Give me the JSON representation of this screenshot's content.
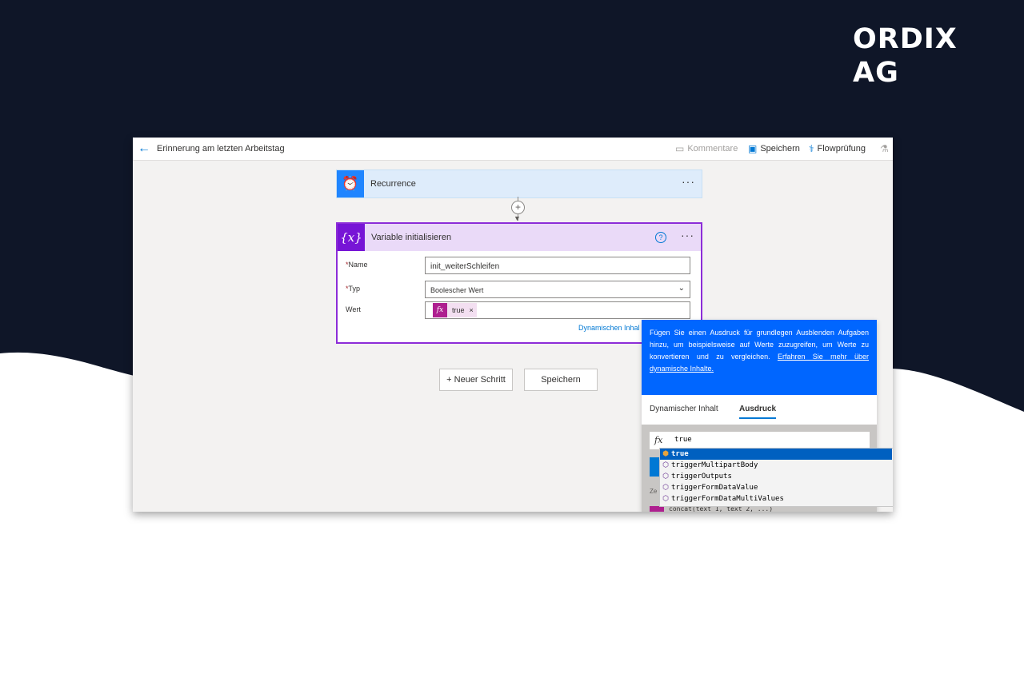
{
  "brand": {
    "logo_text": "ORDIX AG"
  },
  "header": {
    "title": "Erinnerung am letzten Arbeitstag",
    "commands": [
      "Kommentare",
      "Speichern",
      "Flowprüfung"
    ]
  },
  "recurrence": {
    "title": "Recurrence",
    "more": "···"
  },
  "variable_card": {
    "title": "Variable initialisieren",
    "help": "?",
    "more": "···",
    "fields": {
      "name": {
        "label": "Name",
        "required": "*",
        "value": "init_weiterSchleifen"
      },
      "type": {
        "label": "Typ",
        "required": "*",
        "value": "Boolescher Wert"
      },
      "value": {
        "label": "Wert",
        "token": "true",
        "token_icon": "fx",
        "token_remove": "×"
      }
    },
    "dynamic_link": "Dynamischen Inhal"
  },
  "buttons": {
    "new_step": "+ Neuer Schritt",
    "save": "Speichern"
  },
  "panel": {
    "info_text": "Fügen Sie einen Ausdruck für grundlegen Ausblenden Aufgaben hinzu, um beispielsweise auf Werte zuzugreifen, um Werte zu konvertieren und zu vergleichen.",
    "learn_more": "Erfahren Sie mehr über dynamische Inhalte.",
    "tabs": [
      "Dynamischer Inhalt",
      "Ausdruck"
    ],
    "active_tab": "Ausdruck",
    "expression": "true",
    "fx_label": "fx",
    "partial_label": "Ze",
    "partial_function": "concat(text 1, text 2, ...)"
  },
  "suggestions": [
    {
      "text": "true",
      "selected": true
    },
    {
      "text": "triggerMultipartBody",
      "selected": false
    },
    {
      "text": "triggerOutputs",
      "selected": false
    },
    {
      "text": "triggerFormDataValue",
      "selected": false
    },
    {
      "text": "triggerFormDataMultiValues",
      "selected": false
    }
  ],
  "colors": {
    "navy": "#0f1628",
    "recurrence_accent": "#1f85ff",
    "variable_accent": "#7715d6",
    "panel_blue": "#0066ff",
    "token_accent": "#ae1f8f"
  },
  "icons": {
    "back": "arrow-left-icon",
    "comments": "comment-icon",
    "save": "save-icon",
    "checker": "stethoscope-icon",
    "test": "flask-icon",
    "recurrence": "alarm-clock-icon",
    "variable": "variable-braces-icon",
    "suggestion": "cube-icon"
  }
}
